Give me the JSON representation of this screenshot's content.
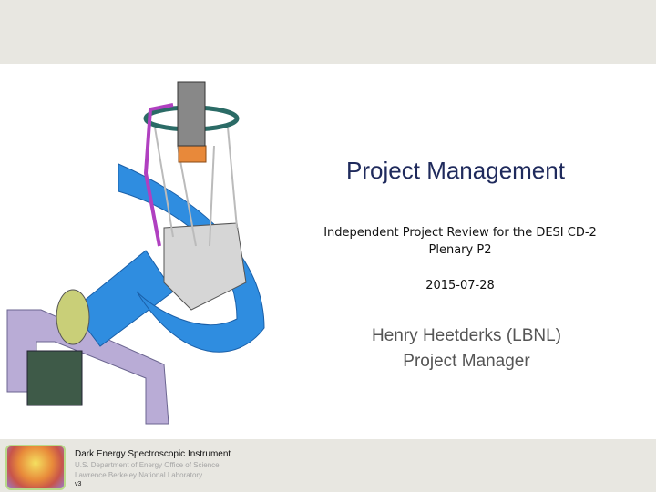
{
  "slide": {
    "title": "Project Management",
    "review_line1": "Independent Project Review for the DESI  CD-2",
    "review_line2": "Plenary P2",
    "date": "2015-07-28",
    "presenter_name": "Henry Heetderks (LBNL)",
    "presenter_role": "Project Manager"
  },
  "footer": {
    "project": "Dark Energy Spectroscopic Instrument",
    "agency": "U.S. Department of Energy Office of Science",
    "lab": "Lawrence Berkeley National Laboratory",
    "version": "v3"
  }
}
